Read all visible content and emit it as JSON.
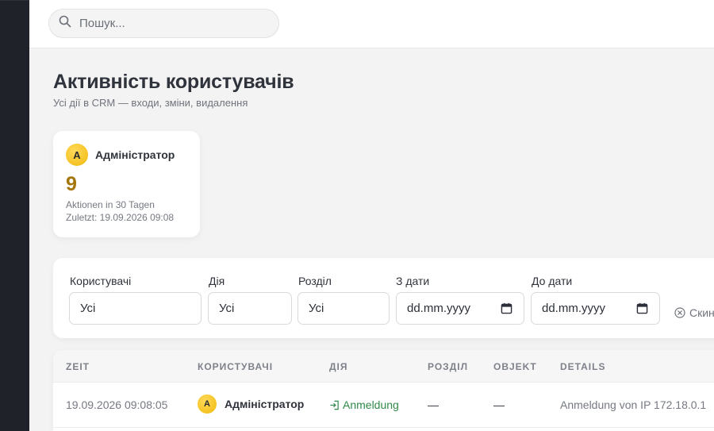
{
  "search": {
    "placeholder": "Пошук..."
  },
  "page": {
    "title": "Активність користувачів",
    "subtitle": "Усі дії в CRM — входи, зміни, видалення"
  },
  "stat_card": {
    "avatar_initial": "A",
    "user_name": "Адміністратор",
    "count": "9",
    "actions_label": "Aktionen in 30 Tagen",
    "last_label": "Zuletzt: 19.09.2026 09:08"
  },
  "filters": {
    "user_label": "Користувачі",
    "user_value": "Усі",
    "action_label": "Дія",
    "action_value": "Усі",
    "section_label": "Розділ",
    "section_value": "Усі",
    "from_label": "З дати",
    "from_placeholder": "dd.mm.yyyy",
    "to_label": "До дати",
    "to_placeholder": "dd.mm.yyyy",
    "reset_label": "Скин"
  },
  "table": {
    "headers": [
      "ZEIT",
      "КОРИСТУВАЧІ",
      "ДІЯ",
      "РОЗДІЛ",
      "OBJEKT",
      "DETAILS"
    ],
    "rows": [
      {
        "time": "19.09.2026 09:08:05",
        "avatar_initial": "A",
        "user": "Адміністратор",
        "action": "Anmeldung",
        "section": "—",
        "object": "—",
        "details": "Anmeldung von IP 172.18.0.1"
      }
    ]
  },
  "colors": {
    "accent_gold": "#a4760c",
    "avatar_yellow": "#f0b90a",
    "action_green": "#2f8a4a",
    "sidebar_dark": "#1f2229"
  }
}
